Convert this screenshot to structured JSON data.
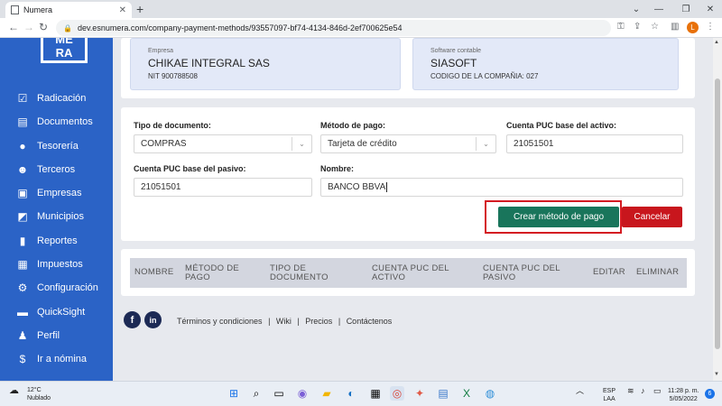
{
  "browser": {
    "tab_title": "Numera",
    "url": "dev.esnumera.com/company-payment-methods/93557097-bf74-4134-846d-2ef700625e54",
    "profile_initial": "L",
    "colors": {
      "profile": "#e8710a"
    }
  },
  "sidebar": {
    "logo_line1": "ME",
    "logo_line2": "RA",
    "items": [
      {
        "label": "Radicación",
        "icon": "check-square-icon"
      },
      {
        "label": "Documentos",
        "icon": "documents-icon"
      },
      {
        "label": "Tesorería",
        "icon": "money-bag-icon"
      },
      {
        "label": "Terceros",
        "icon": "users-icon"
      },
      {
        "label": "Empresas",
        "icon": "briefcase-icon"
      },
      {
        "label": "Municipios",
        "icon": "map-icon"
      },
      {
        "label": "Reportes",
        "icon": "report-icon"
      },
      {
        "label": "Impuestos",
        "icon": "calculator-icon"
      },
      {
        "label": "Configuración",
        "icon": "gear-icon"
      },
      {
        "label": "QuickSight",
        "icon": "chat-icon"
      },
      {
        "label": "Perfil",
        "icon": "user-icon"
      },
      {
        "label": "Ir a nómina",
        "icon": "money-icon"
      }
    ]
  },
  "company": {
    "company_caption": "Empresa",
    "company_name": "CHIKAE INTEGRAL SAS",
    "nit": "NIT 900788508",
    "software_caption": "Software contable",
    "software_name": "SIASOFT",
    "company_code": "CODIGO DE LA COMPAÑIA: 027"
  },
  "form": {
    "doc_type_label": "Tipo de documento:",
    "doc_type_value": "COMPRAS",
    "payment_method_label": "Método de pago:",
    "payment_method_value": "Tarjeta de crédito",
    "puc_asset_label": "Cuenta PUC base del activo:",
    "puc_asset_value": "21051501",
    "puc_liability_label": "Cuenta PUC base del pasivo:",
    "puc_liability_value": "21051501",
    "name_label": "Nombre:",
    "name_value": "BANCO BBVA",
    "create_button": "Crear método de pago",
    "cancel_button": "Cancelar"
  },
  "table": {
    "headers": [
      "NOMBRE",
      "MÉTODO DE PAGO",
      "TIPO DE DOCUMENTO",
      "CUENTA PUC DEL ACTIVO",
      "CUENTA PUC DEL PASIVO",
      "EDITAR",
      "ELIMINAR"
    ]
  },
  "footer": {
    "facebook": "f",
    "linkedin": "in",
    "link1": "Términos y condiciones",
    "link2": "Wiki",
    "link3": "Precios",
    "link4": "Contáctenos",
    "sep": "|"
  },
  "taskbar": {
    "temp": "12°C",
    "weather": "Nublado",
    "lang1": "ESP",
    "lang2": "LAA",
    "time": "11:28 p. m.",
    "date": "5/05/2022",
    "notifications": "6"
  },
  "colors": {
    "sidebar": "#2b63c6",
    "primary_button": "#19755b",
    "cancel_button": "#c8161d",
    "highlight": "#d41b22"
  }
}
